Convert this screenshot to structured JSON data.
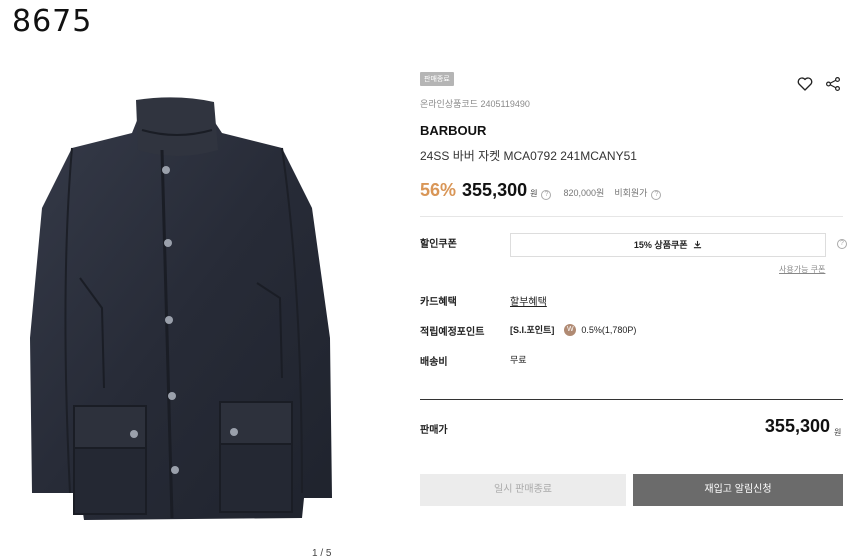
{
  "page_code": "8675",
  "gallery": {
    "counter": "1 / 5"
  },
  "product": {
    "status_badge": "판매종료",
    "online_code_label": "온라인상품코드",
    "online_code": "2405119490",
    "brand": "BARBOUR",
    "name": "24SS 바버 자켓 MCA0792 241MCANY51",
    "discount": "56%",
    "price": "355,300",
    "won": "원",
    "original_price": "820,000원",
    "member_price_label": "비회원가",
    "help_glyph": "?"
  },
  "benefits": {
    "coupon_label": "할인쿠폰",
    "coupon_button": "15% 상품쿠폰",
    "available_coupons": "사용가능 쿠폰",
    "card_label": "카드혜택",
    "card_link": "할부혜택",
    "points_label": "적립예정포인트",
    "points_name": "[S.I.포인트]",
    "points_icon_glyph": "W",
    "points_value": "0.5%(1,780P)",
    "shipping_label": "배송비",
    "shipping_value": "무료"
  },
  "summary": {
    "sale_price_label": "판매가",
    "sale_price": "355,300",
    "won": "원"
  },
  "actions": {
    "sold_out": "일시 판매종료",
    "restock_alert": "재입고 알림신청"
  },
  "icons": [
    "heart-icon",
    "share-icon",
    "download-icon",
    "help-icon"
  ],
  "colors": {
    "discount": "#d99657",
    "restock_button": "#6b6b6b",
    "jacket": "#2a2e3a"
  }
}
